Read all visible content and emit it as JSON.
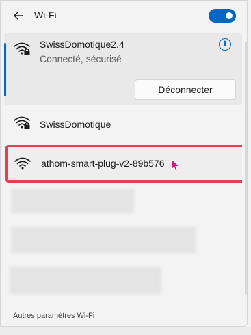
{
  "header": {
    "title": "Wi-Fi",
    "back_icon": "back-arrow-icon",
    "toggle_state": "on"
  },
  "colors": {
    "accent": "#0067c0",
    "highlight_border": "#e0424f",
    "cursor": "#e0157a"
  },
  "connected_network": {
    "name": "SwissDomotique2.4",
    "status": "Connecté, sécurisé",
    "disconnect_label": "Déconnecter",
    "info_glyph": "i",
    "icon": "wifi-secured-icon"
  },
  "networks": [
    {
      "name": "SwissDomotique",
      "icon": "wifi-secured-icon"
    },
    {
      "name": "athom-smart-plug-v2-89b576",
      "icon": "wifi-open-icon"
    }
  ],
  "footer": {
    "link": "Autres paramètres Wi-Fi"
  }
}
